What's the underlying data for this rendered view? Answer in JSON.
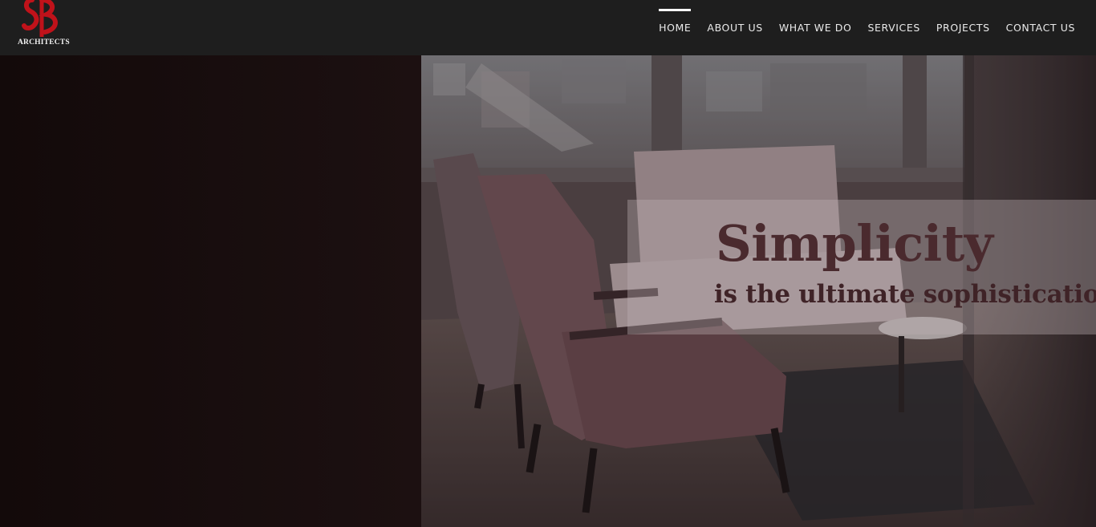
{
  "brand": {
    "logo_text": "ARCHITECTS",
    "accent_color": "#c0121a"
  },
  "nav": {
    "items": [
      {
        "label": "HOME",
        "active": true
      },
      {
        "label": "ABOUT US",
        "active": false
      },
      {
        "label": "WHAT WE DO",
        "active": false
      },
      {
        "label": "SERVICES",
        "active": false
      },
      {
        "label": "PROJECTS",
        "active": false
      },
      {
        "label": "CONTACT US",
        "active": false
      }
    ]
  },
  "hero": {
    "headline": "Simplicity",
    "subheadline": "is the ultimate sophistication"
  }
}
